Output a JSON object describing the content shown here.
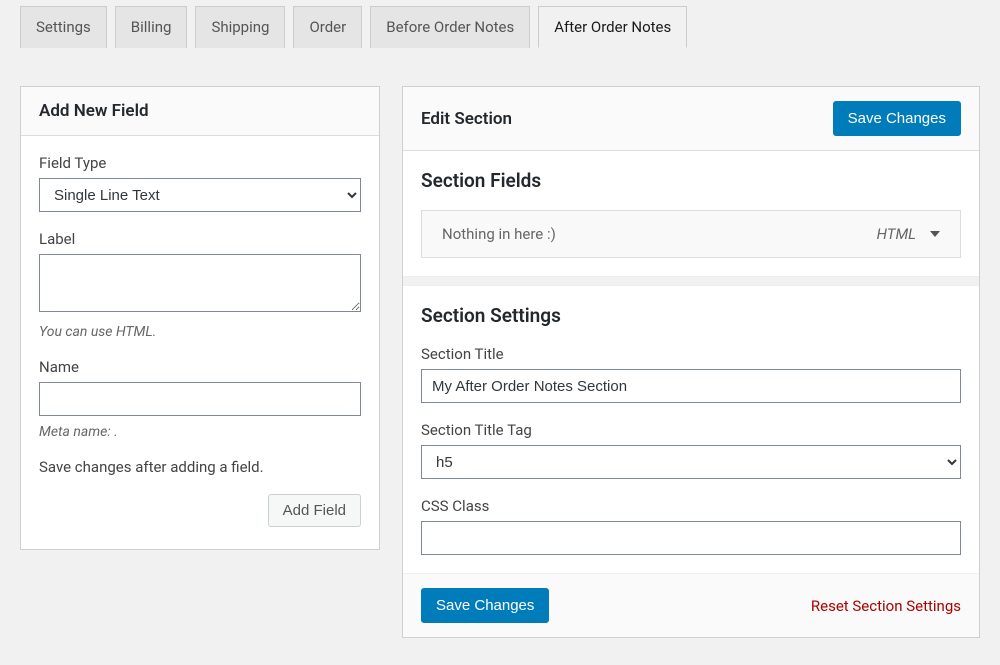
{
  "tabs": [
    {
      "label": "Settings"
    },
    {
      "label": "Billing"
    },
    {
      "label": "Shipping"
    },
    {
      "label": "Order"
    },
    {
      "label": "Before Order Notes"
    },
    {
      "label": "After Order Notes"
    }
  ],
  "addField": {
    "panelTitle": "Add New Field",
    "fieldTypeLabel": "Field Type",
    "fieldTypeValue": "Single Line Text",
    "labelLabel": "Label",
    "labelHelp": "You can use HTML.",
    "nameLabel": "Name",
    "nameHelp": "Meta name: .",
    "noteText": "Save changes after adding a field.",
    "addButton": "Add Field"
  },
  "editSection": {
    "panelTitle": "Edit Section",
    "saveButton": "Save Changes",
    "sectionFields": {
      "title": "Section Fields",
      "emptyText": "Nothing in here :)",
      "dropdownLabel": "HTML"
    },
    "sectionSettings": {
      "title": "Section Settings",
      "sectionTitleLabel": "Section Title",
      "sectionTitleValue": "My After Order Notes Section",
      "sectionTitleTagLabel": "Section Title Tag",
      "sectionTitleTagValue": "h5",
      "cssClassLabel": "CSS Class",
      "cssClassValue": ""
    },
    "footer": {
      "saveButton": "Save Changes",
      "resetLink": "Reset Section Settings"
    }
  }
}
